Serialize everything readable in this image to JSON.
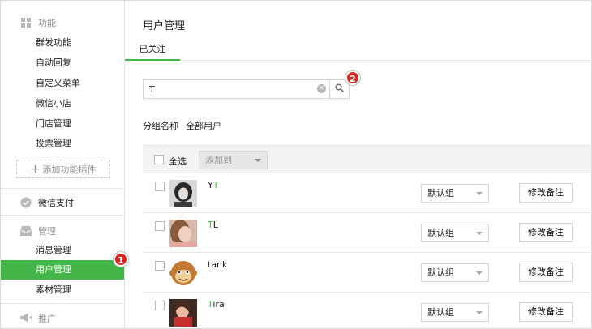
{
  "sidebar": {
    "functions": {
      "header": "功能",
      "icon": "grid-icon",
      "items": [
        {
          "label": "群发功能"
        },
        {
          "label": "自动回复"
        },
        {
          "label": "自定义菜单"
        },
        {
          "label": "微信小店"
        },
        {
          "label": "门店管理"
        },
        {
          "label": "投票管理"
        }
      ],
      "add_plugin_label": "添加功能插件"
    },
    "wechat_pay": {
      "header": "微信支付",
      "icon": "wechat-pay-icon"
    },
    "management": {
      "header": "管理",
      "icon": "inbox-icon",
      "items": [
        {
          "label": "消息管理"
        },
        {
          "label": "用户管理",
          "active": true
        },
        {
          "label": "素材管理"
        }
      ]
    },
    "promotion": {
      "header": "推广",
      "icon": "megaphone-icon"
    },
    "active_color": "#44b549"
  },
  "callouts": {
    "first": "1",
    "second": "2"
  },
  "main": {
    "title": "用户管理",
    "tabs": [
      {
        "label": "已关注",
        "active": true
      }
    ],
    "search": {
      "value": "T",
      "clear_icon": "clear-icon",
      "search_icon": "search-icon"
    },
    "group": {
      "label": "分组名称",
      "value": "全部用户"
    },
    "table": {
      "select_all_label": "全选",
      "add_to_label": "添加到",
      "rows": [
        {
          "name_highlight": "",
          "name_rest": "Y",
          "name_highlight2": "T",
          "group": "默认组",
          "edit_label": "修改备注",
          "avatar": "avatar-girl-bw"
        },
        {
          "name_highlight": "T",
          "name_rest": "L",
          "name_highlight2": "",
          "group": "默认组",
          "edit_label": "修改备注",
          "avatar": "avatar-girl-pink"
        },
        {
          "name_highlight": "",
          "name_rest": "tank",
          "name_highlight2": "",
          "group": "默认组",
          "edit_label": "修改备注",
          "avatar": "avatar-monkey"
        },
        {
          "name_highlight": "T",
          "name_rest": "ira",
          "name_highlight2": "",
          "group": "默认组",
          "edit_label": "修改备注",
          "avatar": "avatar-girl-red"
        }
      ]
    },
    "highlight_color": "#44b549"
  }
}
